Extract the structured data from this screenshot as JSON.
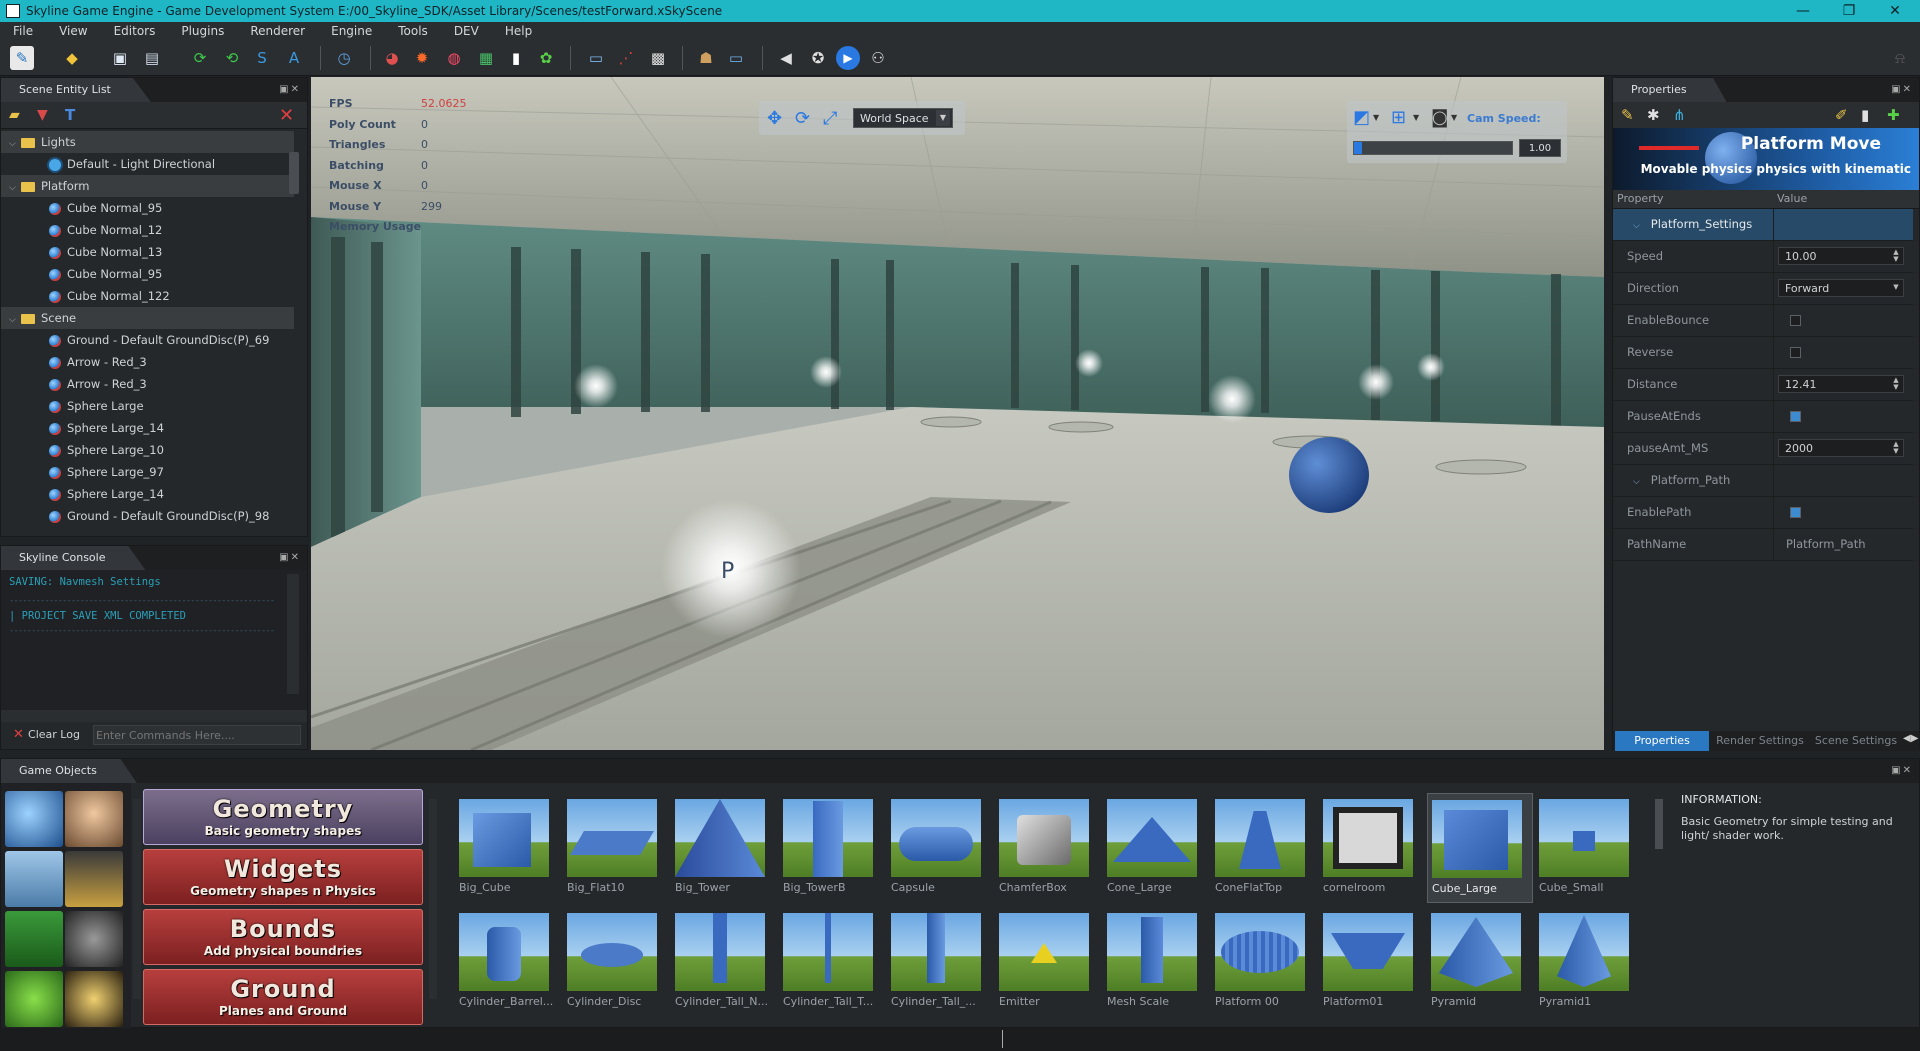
{
  "window": {
    "title": "Skyline Game Engine - Game Development System E:/00_Skyline_SDK/Asset Library/Scenes/testForward.xSkyScene",
    "min": "—",
    "max": "❐",
    "close": "✕"
  },
  "menu": [
    "File",
    "View",
    "Editors",
    "Plugins",
    "Renderer",
    "Engine",
    "Tools",
    "DEV",
    "Help"
  ],
  "entity_list": {
    "title": "Scene Entity List",
    "groups": [
      {
        "name": "Lights",
        "items": [
          "Default - Light Directional"
        ]
      },
      {
        "name": "Platform",
        "items": [
          "Cube Normal_95",
          "Cube Normal_12",
          "Cube Normal_13",
          "Cube Normal_95",
          "Cube Normal_122"
        ]
      },
      {
        "name": "Scene",
        "items": [
          "Ground - Default GroundDisc(P)_69",
          "Arrow - Red_3",
          "Arrow - Red_3",
          "Sphere Large",
          "Sphere Large_14",
          "Sphere Large_10",
          "Sphere Large_97",
          "Sphere Large_14",
          "Ground - Default GroundDisc(P)_98"
        ]
      }
    ]
  },
  "console": {
    "title": "Skyline Console",
    "line1": "SAVING: Navmesh Settings",
    "sep": "------------------------------------------------------------",
    "line2": "| PROJECT SAVE XML COMPLETED",
    "sep2": "------------------------------------------------------------",
    "clear": "Clear Log",
    "placeholder": "Enter Commands Here...."
  },
  "viewport": {
    "stats": [
      {
        "k": "FPS",
        "v": "52.0625"
      },
      {
        "k": "Poly Count",
        "v": "0"
      },
      {
        "k": "Triangles",
        "v": "0"
      },
      {
        "k": "Batching",
        "v": "0"
      },
      {
        "k": "Mouse X",
        "v": "0"
      },
      {
        "k": "Mouse Y",
        "v": "299"
      },
      {
        "k": "Memory Usage",
        "v": ""
      }
    ],
    "space": "World Space",
    "cam_label": "Cam Speed:",
    "cam_value": "1.00",
    "cam_progress": 0.05,
    "light_glyph": "P"
  },
  "properties": {
    "title": "Properties",
    "banner_title": "Platform Move",
    "banner_sub": "Movable physics physics with kinematic",
    "col_property": "Property",
    "col_value": "Value",
    "section1": "Platform_Settings",
    "rows1": [
      {
        "name": "Speed",
        "type": "spin",
        "value": "10.00"
      },
      {
        "name": "Direction",
        "type": "combo",
        "value": "Forward"
      },
      {
        "name": "EnableBounce",
        "type": "check",
        "checked": false
      },
      {
        "name": "Reverse",
        "type": "check",
        "checked": false
      },
      {
        "name": "Distance",
        "type": "spin",
        "value": "12.41"
      },
      {
        "name": "PauseAtEnds",
        "type": "check",
        "checked": true
      },
      {
        "name": "pauseAmt_MS",
        "type": "spin",
        "value": "2000"
      }
    ],
    "section2": "Platform_Path",
    "rows2": [
      {
        "name": "EnablePath",
        "type": "check",
        "checked": true
      },
      {
        "name": "PathName",
        "type": "text",
        "value": "Platform_Path"
      }
    ],
    "tabs": [
      "Properties",
      "Render Settings",
      "Scene Settings"
    ]
  },
  "game_objects": {
    "title": "Game Objects",
    "categories": [
      {
        "title": "Geometry",
        "sub": "Basic geometry shapes",
        "selected": true
      },
      {
        "title": "Widgets",
        "sub": "Geometry shapes n Physics",
        "selected": false
      },
      {
        "title": "Bounds",
        "sub": "Add physical boundries",
        "selected": false
      },
      {
        "title": "Ground",
        "sub": "Planes and Ground",
        "selected": false
      }
    ],
    "row1": [
      "Big_Cube",
      "Big_Flat10",
      "Big_Tower",
      "Big_TowerB",
      "Capsule",
      "ChamferBox",
      "Cone_Large",
      "ConeFlatTop",
      "cornelroom",
      "Cube_Large",
      "Cube_Small"
    ],
    "row2": [
      "Cylinder_Barrel...",
      "Cylinder_Disc",
      "Cylinder_Tall_N...",
      "Cylinder_Tall_T...",
      "Cylinder_Tall_...",
      "Emitter",
      "Mesh Scale",
      "Platform 00",
      "Platform01",
      "Pyramid",
      "Pyramid1"
    ],
    "selected": "Cube_Large",
    "info_title": "INFORMATION:",
    "info_text": "Basic Geometry for simple testing and light/ shader work."
  },
  "colors": {
    "titlebar": "#1fb7c6",
    "accent": "#2a78c2",
    "category": "#a9393a"
  }
}
